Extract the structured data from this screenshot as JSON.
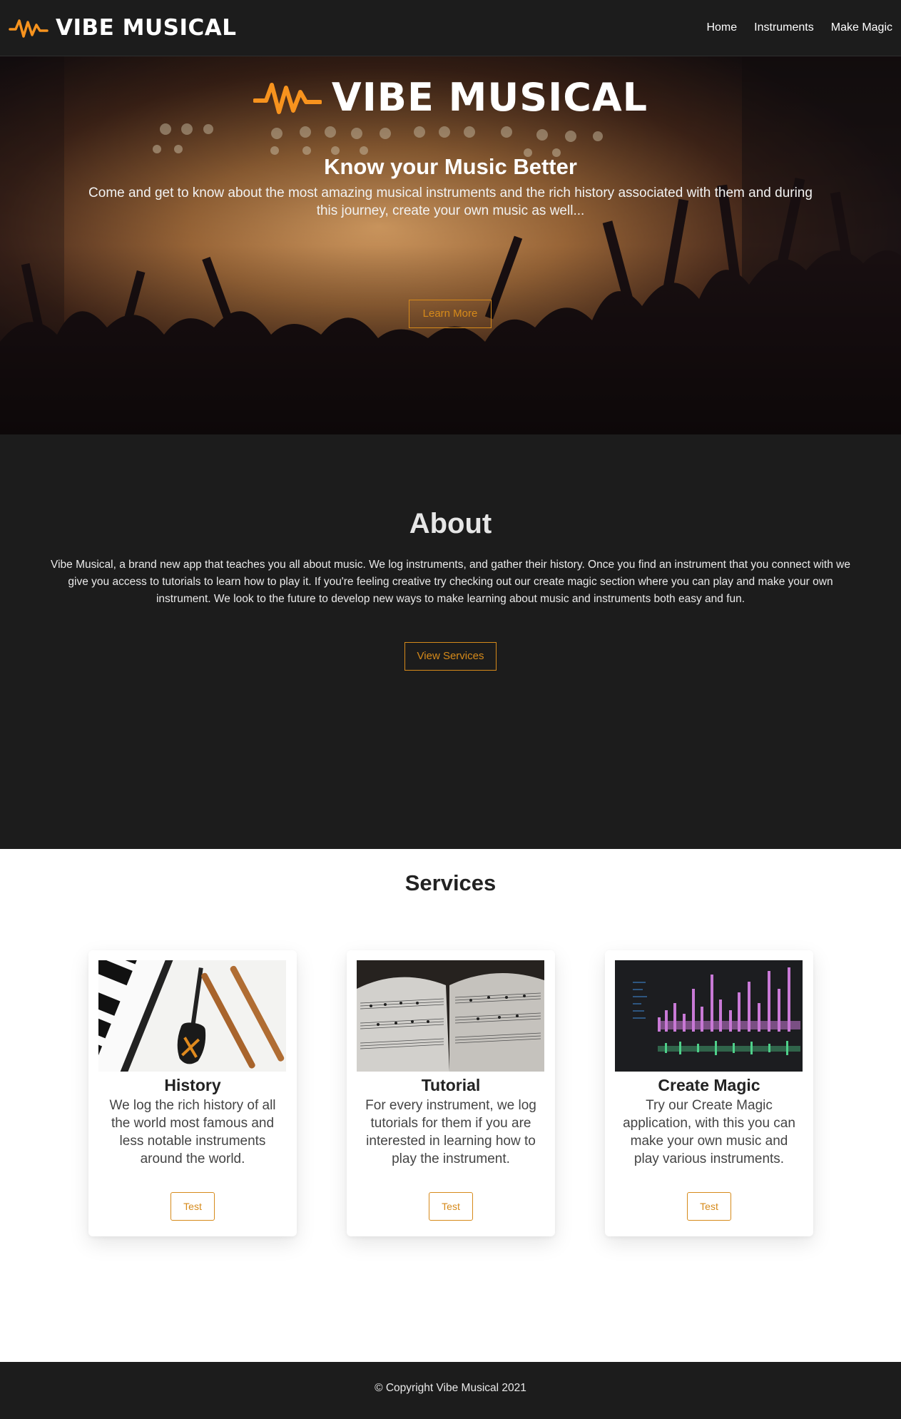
{
  "brand": {
    "name": "VIBE MUSICAL",
    "accent_color": "#f7931e",
    "logo_icon": "pulse-wave-icon"
  },
  "nav": {
    "items": [
      {
        "label": "Home"
      },
      {
        "label": "Instruments"
      },
      {
        "label": "Make Magic"
      }
    ]
  },
  "hero": {
    "logo_text": "VIBE MUSICAL",
    "title": "Know your Music Better",
    "subtitle": "Come and get to know about the most amazing musical instruments and the rich history associated with them and during this journey, create your own music as well...",
    "button_label": "Learn More",
    "background": "concert-crowd-photo"
  },
  "about": {
    "title": "About",
    "text": "Vibe Musical, a brand new app that teaches you all about music. We log instruments, and gather their history. Once you find an instrument that you connect with we give you access to tutorials to learn how to play it. If you're feeling creative try checking out our create magic section where you can play and make your own instrument. We look to the future to develop new ways to make learning about music and instruments both easy and fun.",
    "button_label": "View Services"
  },
  "services": {
    "title": "Services",
    "cards": [
      {
        "image": "instruments-photo",
        "title": "History",
        "text": "We log the rich history of all the world most famous and less notable instruments around the world.",
        "button_label": "Test"
      },
      {
        "image": "sheet-music-photo",
        "title": "Tutorial",
        "text": "For every instrument, we log tutorials for them if you are interested in learning how to play the instrument.",
        "button_label": "Test"
      },
      {
        "image": "audio-editor-photo",
        "title": "Create Magic",
        "text": "Try our Create Magic application, with this you can make your own music and play various instruments.",
        "button_label": "Test"
      }
    ]
  },
  "footer": {
    "text": "© Copyright Vibe Musical 2021"
  },
  "colors": {
    "dark": "#1c1c1c",
    "accent": "#d68a1a",
    "light": "#ffffff"
  }
}
